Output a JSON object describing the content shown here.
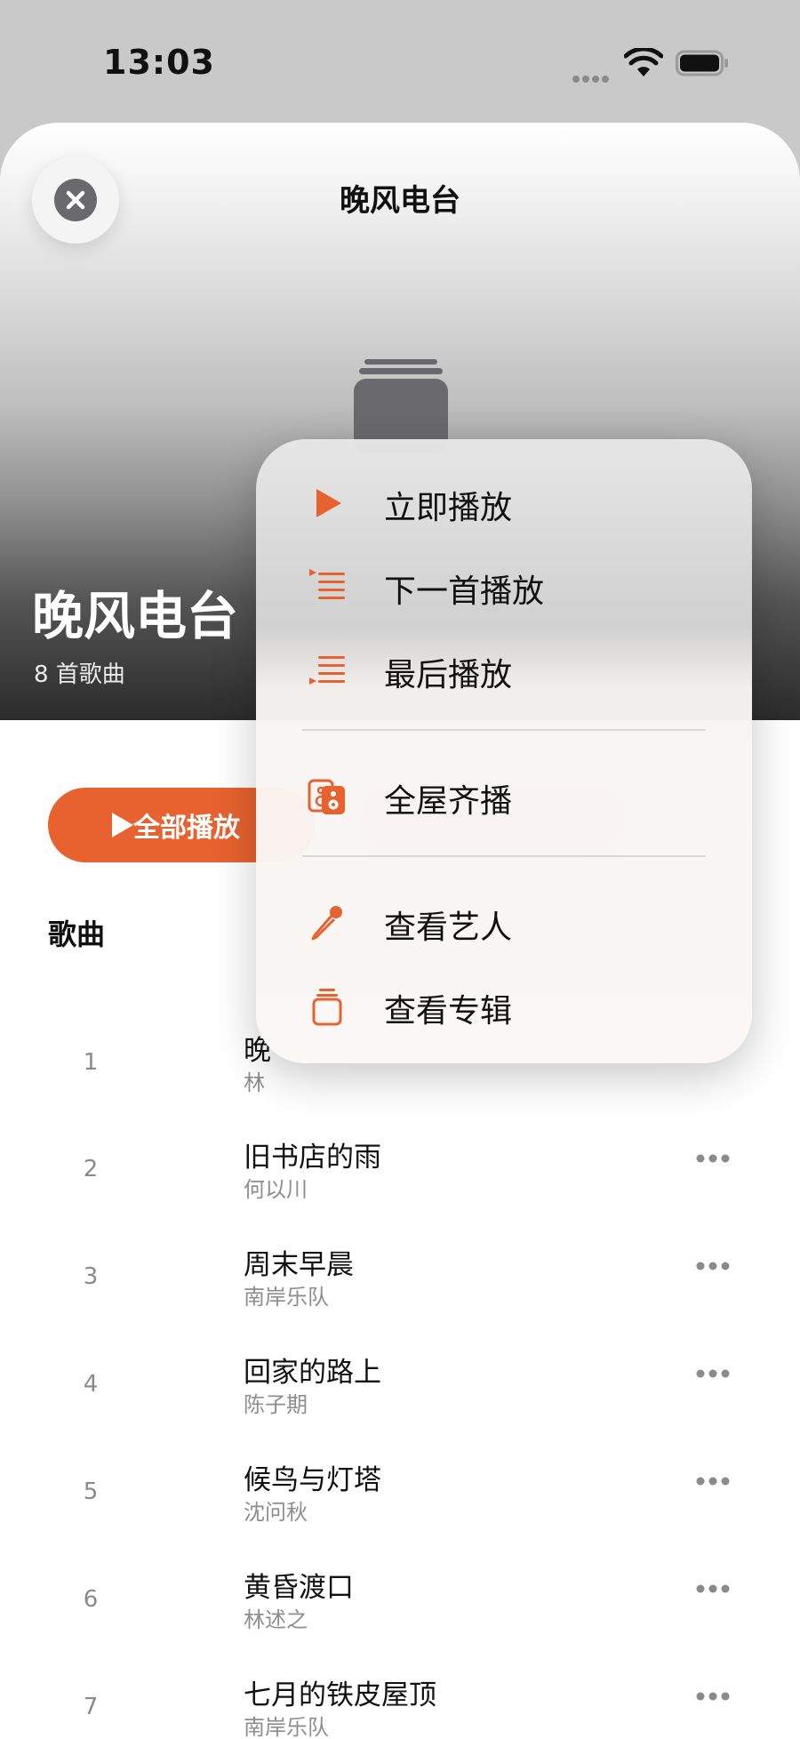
{
  "status_bar": {
    "time": "13:03"
  },
  "header": {
    "nav_title": "晚风电台",
    "playlist_title": "晚风电台",
    "song_count": "8 首歌曲",
    "play_all_label": "全部播放",
    "songs_heading": "歌曲"
  },
  "songs": [
    {
      "num": "1",
      "title": "晚",
      "artist": "林"
    },
    {
      "num": "2",
      "title": "旧书店的雨",
      "artist": "何以川"
    },
    {
      "num": "3",
      "title": "周末早晨",
      "artist": "南岸乐队"
    },
    {
      "num": "4",
      "title": "回家的路上",
      "artist": "陈子期"
    },
    {
      "num": "5",
      "title": "候鸟与灯塔",
      "artist": "沈问秋"
    },
    {
      "num": "6",
      "title": "黄昏渡口",
      "artist": "林述之"
    },
    {
      "num": "7",
      "title": "七月的铁皮屋顶",
      "artist": "南岸乐队"
    }
  ],
  "menu": {
    "items": [
      {
        "label": "立即播放",
        "icon": "play-icon"
      },
      {
        "label": "下一首播放",
        "icon": "play-next-icon"
      },
      {
        "label": "最后播放",
        "icon": "play-last-icon"
      },
      {
        "label": "全屋齐播",
        "icon": "speaker-icon"
      },
      {
        "label": "查看艺人",
        "icon": "microphone-icon"
      },
      {
        "label": "查看专辑",
        "icon": "album-icon"
      }
    ]
  },
  "colors": {
    "accent": "#e8622f"
  }
}
